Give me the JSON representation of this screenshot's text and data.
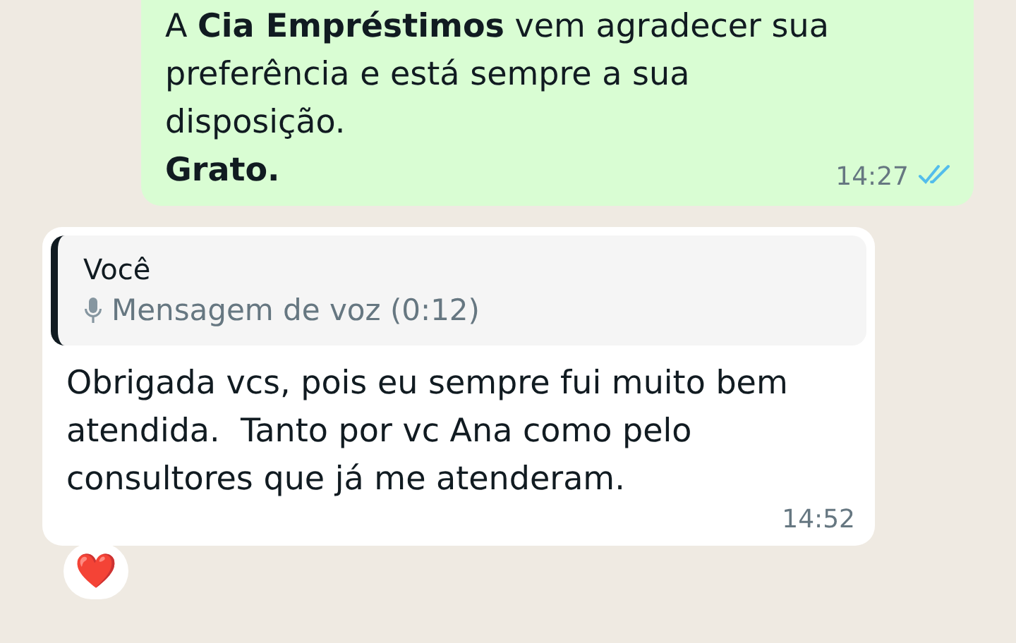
{
  "messages": [
    {
      "kind": "outgoing",
      "text": "A **Cia Empréstimos** vem agradecer sua preferência e está sempre a sua disposição.",
      "signature": "Grato.",
      "time": "14:27",
      "read": true
    },
    {
      "kind": "incoming",
      "quote": {
        "author": "Você",
        "attachment": "Mensagem de voz (0:12)"
      },
      "text": "Obrigada vcs, pois eu sempre fui muito bem atendida.  Tanto por vc Ana como pelo consultores que já me atenderam.",
      "time": "14:52",
      "reaction": "❤️"
    }
  ]
}
